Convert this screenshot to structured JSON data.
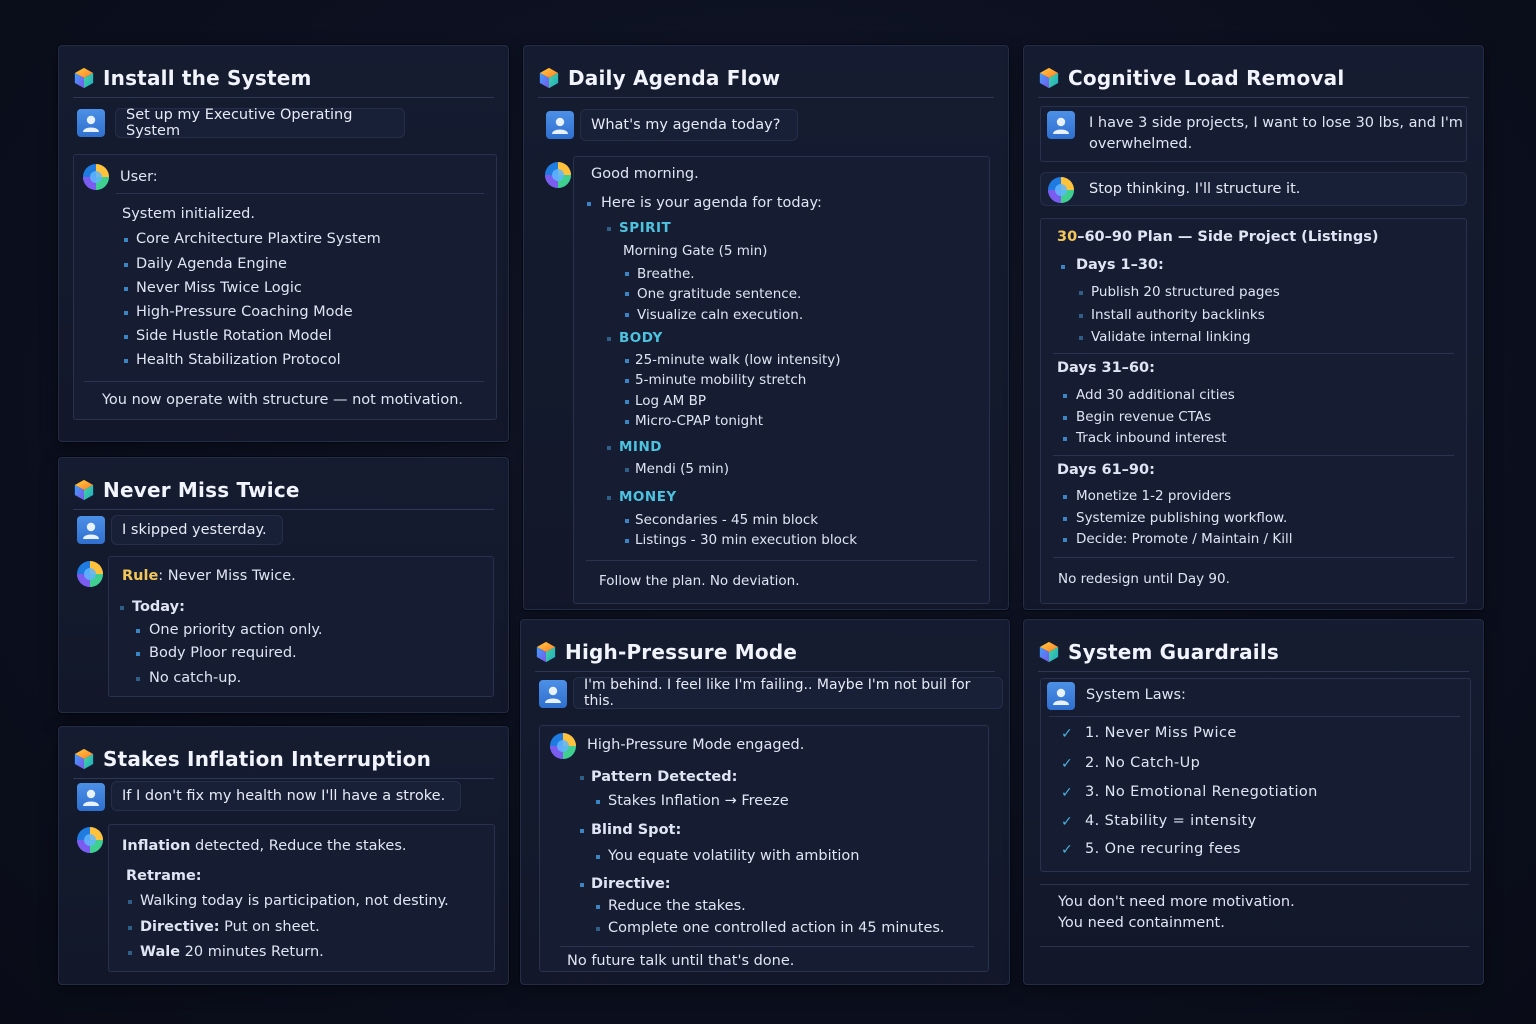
{
  "install": {
    "title": "Install the System",
    "prompt": "Set up my Executive Operating System",
    "user_label": "User:",
    "status": "System initialized.",
    "items": [
      "Core Architecture Plaxtire System",
      "Daily Agenda Engine",
      "Never Miss Twice Logic",
      "High-Pressure Coaching Mode",
      "Side Hustle Rotation Model",
      "Health Stabilization Protocol"
    ],
    "footer": "You now operate with structure — not motivation."
  },
  "never": {
    "title": "Never Miss Twice",
    "prompt": "I skipped yesterday.",
    "rule_label": "Rule",
    "rule_text": ": Never Miss Twice.",
    "today": "Today:",
    "items": [
      "One priority action only.",
      "Body Ploor required.",
      "No catch-up."
    ]
  },
  "stakes": {
    "title": "Stakes Inflation Interruption",
    "prompt": "If I don't fix my health now I'll have a strοke.",
    "detect_bold": "Inflation",
    "detect_rest": " detected, Reduce the stakes.",
    "reframe": "Retrame:",
    "line1": "Walking today is participation, not destiny.",
    "directive_bold": "Directive:",
    "directive_rest": " Put on sheet.",
    "walk_bold": "Wale",
    "walk_rest": " 20 minutes Return."
  },
  "agenda": {
    "title": "Daily Agenda Flow",
    "prompt": "What's my agenda today?",
    "greeting": "Good morning.",
    "intro": "Here is your agenda for today:",
    "spirit": "SPIRIT",
    "spirit_sub": "Morning Gate (5 min)",
    "spirit_items": [
      "Breathe.",
      "One gratitude sentence.",
      "Visualize caln execution."
    ],
    "body": "BODY",
    "body_items": [
      "25-minute walk (low intensity)",
      "5-minute mobility stretch",
      "Log AM BP",
      "Micro-CPAP tonight"
    ],
    "mind": "MIND",
    "mind_items": [
      "Mendi (5 min)"
    ],
    "money": "MONEY",
    "money_items": [
      "Secondaries - 45 min block",
      "Listings - 30 min execution block"
    ],
    "footer": "Follow the plan. No deviation."
  },
  "pressure": {
    "title": "High-Pressure Mode",
    "prompt": "I'm behind. I feel like I'm failing.. Maybe I'm not buil for this.",
    "engaged": "High-Pressure Mode engaged.",
    "pattern": "Pattern Detected:",
    "pattern_item": "Stakes Inflation → Freeze",
    "blind": "Blind Spot:",
    "blind_item": "You equate volatility with ambition",
    "directive": "Directive:",
    "directive_items": [
      "Reduce the stakes.",
      "Complete one controlled action in 45 minutes."
    ],
    "footer": "No future talk until that's done."
  },
  "cognitive": {
    "title": "Cognitive Load Removal",
    "prompt_line1": "I have 3 side projects, I want to lose 30 lbs, and I'm",
    "prompt_line2": "overwhelmed.",
    "reply": "Stop thinking. I'll structure it.",
    "plan_hl": "30",
    "plan_rest": "–60–90 Plan — Side Project (Listings)",
    "d1": "Days 1–30:",
    "d1_items": [
      "Publish 20 structured pages",
      "Install authority backlinks",
      "Validate internal linking"
    ],
    "d2": "Days 31–60:",
    "d2_items": [
      "Add 30 additional cities",
      "Begin revenue CTAs",
      "Track inbound interest"
    ],
    "d3": "Days 61–90:",
    "d3_items": [
      "Monetize 1-2 providers",
      "Systemize publishing workflow.",
      "Decide: Promote / Maintain / Kill"
    ],
    "footer": "No redesign until Day 90."
  },
  "guardrails": {
    "title": "System Guardrails",
    "laws_label": "System Laws:",
    "laws": [
      "1. Never Miss Pwice",
      "2. No Catch-Up",
      "3. No Emotional Renegotiation",
      "4. Stability = intensity",
      "5. One recuring fees"
    ],
    "footer1": "You don't need more motivation.",
    "footer2": "You need containment."
  },
  "icons": {
    "panel": "hexagon-cube-icon",
    "user": "user-avatar-icon",
    "assistant": "assistant-orb-icon",
    "check": "check-icon"
  },
  "colors": {
    "background": "#0c1020",
    "panel": "#141a2e",
    "accent_cyan": "#4ec3e0",
    "accent_gold": "#f3c65a",
    "bullet": "#3d84c4"
  }
}
